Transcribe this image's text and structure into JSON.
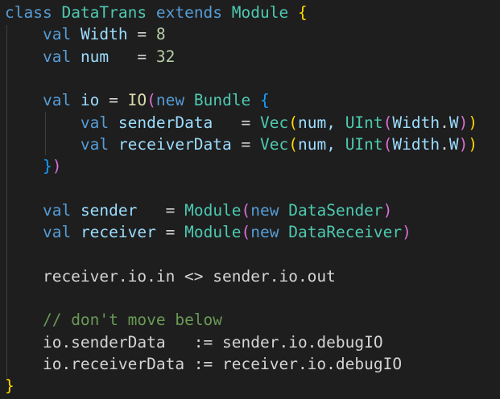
{
  "editor": {
    "lines": [
      [
        {
          "t": "class ",
          "c": "kw"
        },
        {
          "t": "DataTrans ",
          "c": "type"
        },
        {
          "t": "extends ",
          "c": "kw"
        },
        {
          "t": "Module ",
          "c": "type"
        },
        {
          "t": "{",
          "c": "b1"
        }
      ],
      [
        {
          "t": "    ",
          "c": "plain"
        },
        {
          "t": "val ",
          "c": "kw"
        },
        {
          "t": "Width ",
          "c": "var"
        },
        {
          "t": "= ",
          "c": "plain"
        },
        {
          "t": "8",
          "c": "num"
        }
      ],
      [
        {
          "t": "    ",
          "c": "plain"
        },
        {
          "t": "val ",
          "c": "kw"
        },
        {
          "t": "num   ",
          "c": "var"
        },
        {
          "t": "= ",
          "c": "plain"
        },
        {
          "t": "32",
          "c": "num"
        }
      ],
      [],
      [
        {
          "t": "    ",
          "c": "plain"
        },
        {
          "t": "val ",
          "c": "kw"
        },
        {
          "t": "io ",
          "c": "var"
        },
        {
          "t": "= ",
          "c": "plain"
        },
        {
          "t": "IO",
          "c": "fn"
        },
        {
          "t": "(",
          "c": "b2"
        },
        {
          "t": "new ",
          "c": "kw"
        },
        {
          "t": "Bundle ",
          "c": "type"
        },
        {
          "t": "{",
          "c": "b3"
        }
      ],
      [
        {
          "t": "        ",
          "c": "plain"
        },
        {
          "t": "val ",
          "c": "kw"
        },
        {
          "t": "senderData   ",
          "c": "var"
        },
        {
          "t": "= ",
          "c": "plain"
        },
        {
          "t": "Vec",
          "c": "type"
        },
        {
          "t": "(",
          "c": "b1"
        },
        {
          "t": "num, ",
          "c": "var"
        },
        {
          "t": "UInt",
          "c": "type"
        },
        {
          "t": "(",
          "c": "b2"
        },
        {
          "t": "Width",
          "c": "var"
        },
        {
          "t": ".",
          "c": "plain"
        },
        {
          "t": "W",
          "c": "var"
        },
        {
          "t": ")",
          "c": "b2"
        },
        {
          "t": ")",
          "c": "b1"
        }
      ],
      [
        {
          "t": "        ",
          "c": "plain"
        },
        {
          "t": "val ",
          "c": "kw"
        },
        {
          "t": "receiverData ",
          "c": "var"
        },
        {
          "t": "= ",
          "c": "plain"
        },
        {
          "t": "Vec",
          "c": "type"
        },
        {
          "t": "(",
          "c": "b1"
        },
        {
          "t": "num, ",
          "c": "var"
        },
        {
          "t": "UInt",
          "c": "type"
        },
        {
          "t": "(",
          "c": "b2"
        },
        {
          "t": "Width",
          "c": "var"
        },
        {
          "t": ".",
          "c": "plain"
        },
        {
          "t": "W",
          "c": "var"
        },
        {
          "t": ")",
          "c": "b2"
        },
        {
          "t": ")",
          "c": "b1"
        }
      ],
      [
        {
          "t": "    ",
          "c": "plain"
        },
        {
          "t": "}",
          "c": "b3"
        },
        {
          "t": ")",
          "c": "b2"
        }
      ],
      [],
      [
        {
          "t": "    ",
          "c": "plain"
        },
        {
          "t": "val ",
          "c": "kw"
        },
        {
          "t": "sender   ",
          "c": "var"
        },
        {
          "t": "= ",
          "c": "plain"
        },
        {
          "t": "Module",
          "c": "type"
        },
        {
          "t": "(",
          "c": "b2"
        },
        {
          "t": "new ",
          "c": "kw"
        },
        {
          "t": "DataSender",
          "c": "type"
        },
        {
          "t": ")",
          "c": "b2"
        }
      ],
      [
        {
          "t": "    ",
          "c": "plain"
        },
        {
          "t": "val ",
          "c": "kw"
        },
        {
          "t": "receiver ",
          "c": "var"
        },
        {
          "t": "= ",
          "c": "plain"
        },
        {
          "t": "Module",
          "c": "type"
        },
        {
          "t": "(",
          "c": "b2"
        },
        {
          "t": "new ",
          "c": "kw"
        },
        {
          "t": "DataReceiver",
          "c": "type"
        },
        {
          "t": ")",
          "c": "b2"
        }
      ],
      [],
      [
        {
          "t": "    receiver.io.in <> sender.io.out",
          "c": "plain"
        }
      ],
      [],
      [
        {
          "t": "    ",
          "c": "plain"
        },
        {
          "t": "// don't move below",
          "c": "cmt"
        }
      ],
      [
        {
          "t": "    io.senderData   := sender.io.debugIO",
          "c": "plain"
        }
      ],
      [
        {
          "t": "    io.receiverData := receiver.io.debugIO",
          "c": "plain"
        }
      ],
      [
        {
          "t": "}",
          "c": "b1"
        }
      ]
    ]
  }
}
